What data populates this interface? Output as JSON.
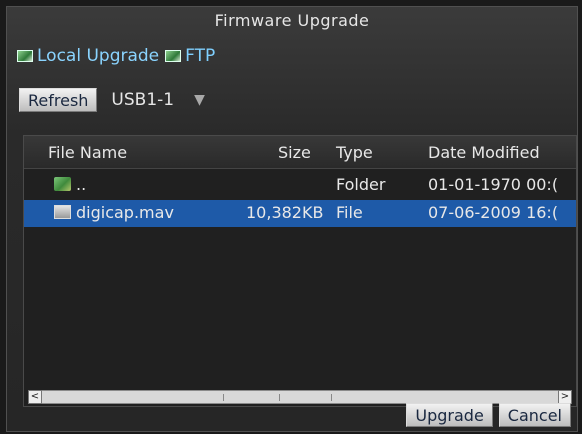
{
  "window": {
    "title": "Firmware Upgrade"
  },
  "tabs": [
    {
      "label": "Local Upgrade",
      "icon": "network-icon"
    },
    {
      "label": "FTP",
      "icon": "network-icon"
    }
  ],
  "toolbar": {
    "refresh_label": "Refresh",
    "device": "USB1-1"
  },
  "list": {
    "columns": [
      "File Name",
      "Size",
      "Type",
      "Date Modified"
    ],
    "rows": [
      {
        "name": "..",
        "size": "",
        "type": "Folder",
        "modified": "01-01-1970 00:(",
        "icon": "folder-icon",
        "selected": false
      },
      {
        "name": "digicap.mav",
        "size": "10,382KB",
        "type": "File",
        "modified": "07-06-2009 16:(",
        "icon": "file-icon",
        "selected": true
      }
    ]
  },
  "footer": {
    "upgrade_label": "Upgrade",
    "cancel_label": "Cancel"
  },
  "colors": {
    "accent_text": "#7fd0ff",
    "selection": "#1e5aa8",
    "background": "#262626"
  }
}
